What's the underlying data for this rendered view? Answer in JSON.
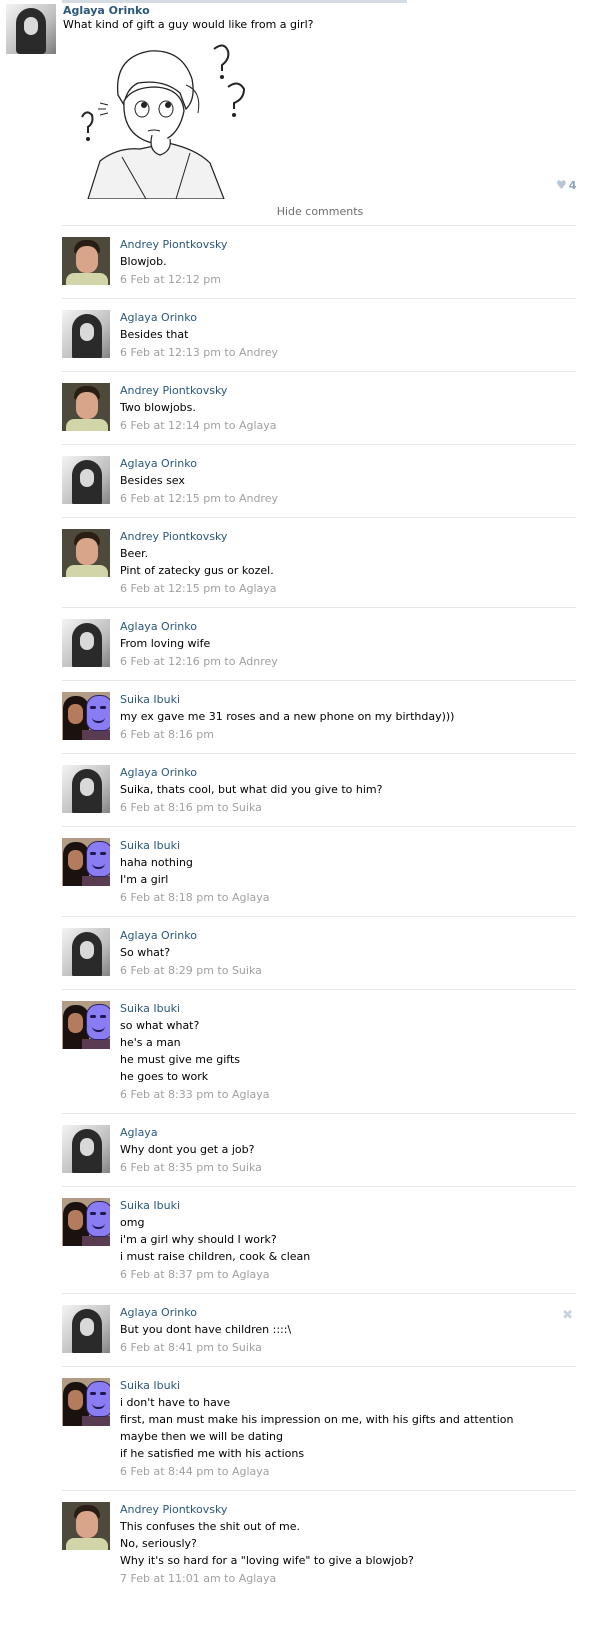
{
  "post": {
    "author": "Aglaya Orinko",
    "text": "What kind of gift a guy would like from a girl?",
    "likes": "4",
    "like_icon": "heart-icon"
  },
  "hide_comments": "Hide comments",
  "comments": [
    {
      "avatar": "andrey",
      "name": "Andrey Piontkovsky",
      "lines": [
        "Blowjob."
      ],
      "meta": "6 Feb at 12:12 pm"
    },
    {
      "avatar": "aglaya",
      "name": "Aglaya Orinko",
      "lines": [
        "Besides that"
      ],
      "meta": "6 Feb at 12:13 pm to Andrey"
    },
    {
      "avatar": "andrey",
      "name": "Andrey Piontkovsky",
      "lines": [
        "Two blowjobs."
      ],
      "meta": "6 Feb at 12:14 pm to Aglaya"
    },
    {
      "avatar": "aglaya",
      "name": "Aglaya Orinko",
      "lines": [
        "Besides sex"
      ],
      "meta": "6 Feb at 12:15 pm to Andrey"
    },
    {
      "avatar": "andrey",
      "name": "Andrey Piontkovsky",
      "lines": [
        "Beer.",
        "Pint of zatecky gus or kozel."
      ],
      "meta": "6 Feb at 12:15 pm to Aglaya"
    },
    {
      "avatar": "aglaya",
      "name": "Aglaya Orinko",
      "lines": [
        "From loving wife"
      ],
      "meta": "6 Feb at 12:16 pm to Adnrey"
    },
    {
      "avatar": "suika",
      "name": "Suika Ibuki",
      "lines": [
        "my ex gave me 31 roses and a new phone on my birthday)))"
      ],
      "meta": "6 Feb at 8:16 pm"
    },
    {
      "avatar": "aglaya",
      "name": "Aglaya Orinko",
      "lines": [
        "Suika, thats cool, but what did you give to him?"
      ],
      "meta": "6 Feb at 8:16 pm to Suika"
    },
    {
      "avatar": "suika",
      "name": "Suika Ibuki",
      "lines": [
        "haha nothing",
        "I'm a girl"
      ],
      "meta": "6 Feb at 8:18 pm to Aglaya"
    },
    {
      "avatar": "aglaya",
      "name": "Aglaya Orinko",
      "lines": [
        "So what?"
      ],
      "meta": "6 Feb at 8:29 pm to Suika"
    },
    {
      "avatar": "suika",
      "name": "Suika Ibuki",
      "lines": [
        "so what what?",
        "he's a man",
        "he must give me gifts",
        "he goes to work"
      ],
      "meta": "6 Feb at 8:33 pm to Aglaya"
    },
    {
      "avatar": "aglaya",
      "name": "Aglaya",
      "lines": [
        "Why dont you get a job?"
      ],
      "meta": "6 Feb at 8:35 pm to Suika"
    },
    {
      "avatar": "suika",
      "name": "Suika Ibuki",
      "lines": [
        "omg",
        "i'm a girl why should I work?",
        "i must raise children, cook & clean"
      ],
      "meta": "6 Feb at 8:37 pm to Aglaya"
    },
    {
      "avatar": "aglaya",
      "name": "Aglaya Orinko",
      "lines": [
        "But you dont have children ::::\\"
      ],
      "meta": "6 Feb at 8:41 pm to Suika",
      "delete": "✖"
    },
    {
      "avatar": "suika",
      "name": "Suika Ibuki",
      "lines": [
        "i don't have to have",
        "first, man must make his impression on me, with his gifts and attention",
        "maybe then we will be dating",
        "if he satisfied me with his actions"
      ],
      "meta": "6 Feb at 8:44 pm to Aglaya"
    },
    {
      "avatar": "andrey",
      "name": "Andrey Piontkovsky",
      "lines": [
        "This confuses the shit out of me.",
        "No, seriously?",
        "Why it's so hard for a \"loving wife\" to give a blowjob?"
      ],
      "meta": "7 Feb at 11:01 am to Aglaya"
    }
  ]
}
